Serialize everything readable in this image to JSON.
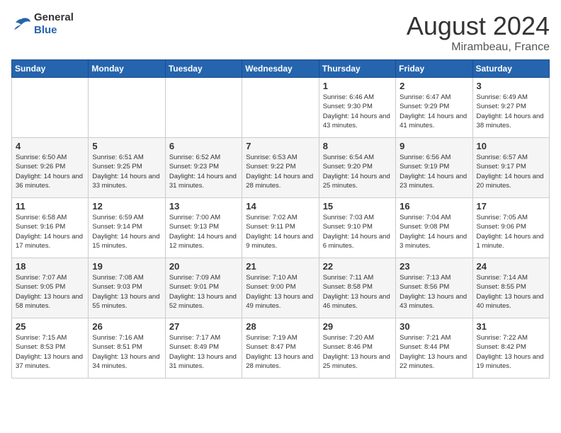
{
  "header": {
    "logo": {
      "general": "General",
      "blue": "Blue"
    },
    "title": "August 2024",
    "location": "Mirambeau, France"
  },
  "weekdays": [
    "Sunday",
    "Monday",
    "Tuesday",
    "Wednesday",
    "Thursday",
    "Friday",
    "Saturday"
  ],
  "weeks": [
    [
      {
        "day": "",
        "content": ""
      },
      {
        "day": "",
        "content": ""
      },
      {
        "day": "",
        "content": ""
      },
      {
        "day": "",
        "content": ""
      },
      {
        "day": "1",
        "content": "Sunrise: 6:46 AM\nSunset: 9:30 PM\nDaylight: 14 hours\nand 43 minutes."
      },
      {
        "day": "2",
        "content": "Sunrise: 6:47 AM\nSunset: 9:29 PM\nDaylight: 14 hours\nand 41 minutes."
      },
      {
        "day": "3",
        "content": "Sunrise: 6:49 AM\nSunset: 9:27 PM\nDaylight: 14 hours\nand 38 minutes."
      }
    ],
    [
      {
        "day": "4",
        "content": "Sunrise: 6:50 AM\nSunset: 9:26 PM\nDaylight: 14 hours\nand 36 minutes."
      },
      {
        "day": "5",
        "content": "Sunrise: 6:51 AM\nSunset: 9:25 PM\nDaylight: 14 hours\nand 33 minutes."
      },
      {
        "day": "6",
        "content": "Sunrise: 6:52 AM\nSunset: 9:23 PM\nDaylight: 14 hours\nand 31 minutes."
      },
      {
        "day": "7",
        "content": "Sunrise: 6:53 AM\nSunset: 9:22 PM\nDaylight: 14 hours\nand 28 minutes."
      },
      {
        "day": "8",
        "content": "Sunrise: 6:54 AM\nSunset: 9:20 PM\nDaylight: 14 hours\nand 25 minutes."
      },
      {
        "day": "9",
        "content": "Sunrise: 6:56 AM\nSunset: 9:19 PM\nDaylight: 14 hours\nand 23 minutes."
      },
      {
        "day": "10",
        "content": "Sunrise: 6:57 AM\nSunset: 9:17 PM\nDaylight: 14 hours\nand 20 minutes."
      }
    ],
    [
      {
        "day": "11",
        "content": "Sunrise: 6:58 AM\nSunset: 9:16 PM\nDaylight: 14 hours\nand 17 minutes."
      },
      {
        "day": "12",
        "content": "Sunrise: 6:59 AM\nSunset: 9:14 PM\nDaylight: 14 hours\nand 15 minutes."
      },
      {
        "day": "13",
        "content": "Sunrise: 7:00 AM\nSunset: 9:13 PM\nDaylight: 14 hours\nand 12 minutes."
      },
      {
        "day": "14",
        "content": "Sunrise: 7:02 AM\nSunset: 9:11 PM\nDaylight: 14 hours\nand 9 minutes."
      },
      {
        "day": "15",
        "content": "Sunrise: 7:03 AM\nSunset: 9:10 PM\nDaylight: 14 hours\nand 6 minutes."
      },
      {
        "day": "16",
        "content": "Sunrise: 7:04 AM\nSunset: 9:08 PM\nDaylight: 14 hours\nand 3 minutes."
      },
      {
        "day": "17",
        "content": "Sunrise: 7:05 AM\nSunset: 9:06 PM\nDaylight: 14 hours\nand 1 minute."
      }
    ],
    [
      {
        "day": "18",
        "content": "Sunrise: 7:07 AM\nSunset: 9:05 PM\nDaylight: 13 hours\nand 58 minutes."
      },
      {
        "day": "19",
        "content": "Sunrise: 7:08 AM\nSunset: 9:03 PM\nDaylight: 13 hours\nand 55 minutes."
      },
      {
        "day": "20",
        "content": "Sunrise: 7:09 AM\nSunset: 9:01 PM\nDaylight: 13 hours\nand 52 minutes."
      },
      {
        "day": "21",
        "content": "Sunrise: 7:10 AM\nSunset: 9:00 PM\nDaylight: 13 hours\nand 49 minutes."
      },
      {
        "day": "22",
        "content": "Sunrise: 7:11 AM\nSunset: 8:58 PM\nDaylight: 13 hours\nand 46 minutes."
      },
      {
        "day": "23",
        "content": "Sunrise: 7:13 AM\nSunset: 8:56 PM\nDaylight: 13 hours\nand 43 minutes."
      },
      {
        "day": "24",
        "content": "Sunrise: 7:14 AM\nSunset: 8:55 PM\nDaylight: 13 hours\nand 40 minutes."
      }
    ],
    [
      {
        "day": "25",
        "content": "Sunrise: 7:15 AM\nSunset: 8:53 PM\nDaylight: 13 hours\nand 37 minutes."
      },
      {
        "day": "26",
        "content": "Sunrise: 7:16 AM\nSunset: 8:51 PM\nDaylight: 13 hours\nand 34 minutes."
      },
      {
        "day": "27",
        "content": "Sunrise: 7:17 AM\nSunset: 8:49 PM\nDaylight: 13 hours\nand 31 minutes."
      },
      {
        "day": "28",
        "content": "Sunrise: 7:19 AM\nSunset: 8:47 PM\nDaylight: 13 hours\nand 28 minutes."
      },
      {
        "day": "29",
        "content": "Sunrise: 7:20 AM\nSunset: 8:46 PM\nDaylight: 13 hours\nand 25 minutes."
      },
      {
        "day": "30",
        "content": "Sunrise: 7:21 AM\nSunset: 8:44 PM\nDaylight: 13 hours\nand 22 minutes."
      },
      {
        "day": "31",
        "content": "Sunrise: 7:22 AM\nSunset: 8:42 PM\nDaylight: 13 hours\nand 19 minutes."
      }
    ]
  ]
}
